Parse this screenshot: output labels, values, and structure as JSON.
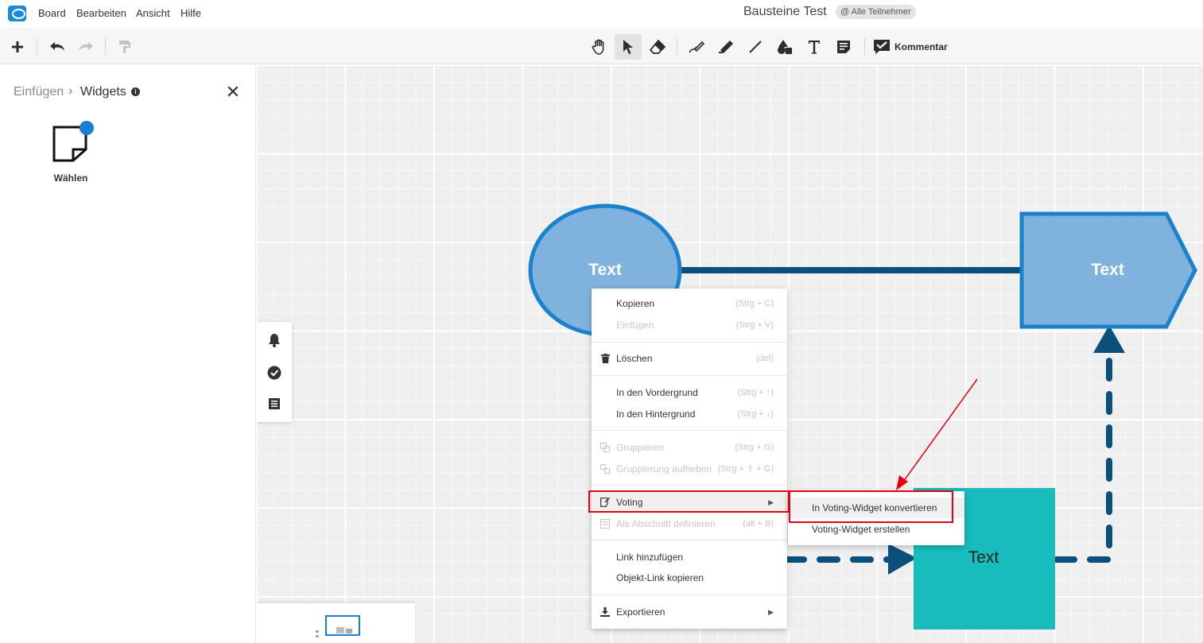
{
  "menubar": {
    "items": [
      "Board",
      "Bearbeiten",
      "Ansicht",
      "Hilfe"
    ],
    "board_title": "Bausteine Test",
    "participants": "@ Alle Teilnehmer"
  },
  "toolbar": {
    "comment_label": "Kommentar"
  },
  "sidebar": {
    "breadcrumb_root": "Einfügen",
    "breadcrumb_sep": "›",
    "breadcrumb_current": "Widgets",
    "close": "✕",
    "widget_label": "Wählen"
  },
  "diagram": {
    "ellipse_text": "Text",
    "pentagon_text": "Text",
    "square_text": "Text",
    "colors": {
      "shape_fill": "#7fb2dd",
      "shape_border": "#1a82cc",
      "connector": "#0b4f7d",
      "square_fill": "#18bcbc"
    }
  },
  "context_menu": {
    "items": [
      {
        "label": "Kopieren",
        "shortcut": "(Strg + C)"
      },
      {
        "label": "Einfügen",
        "shortcut": "(Strg + V)"
      },
      {
        "label": "Löschen",
        "shortcut": "(del)"
      },
      {
        "label": "In den Vordergrund",
        "shortcut": "(Strg + ↑)"
      },
      {
        "label": "In den Hintergrund",
        "shortcut": "(Strg + ↓)"
      },
      {
        "label": "Gruppieren",
        "shortcut": "(Strg + G)"
      },
      {
        "label": "Gruppierung aufheben",
        "shortcut": "(Strg + ⇧ + G)"
      },
      {
        "label": "Voting"
      },
      {
        "label": "Als Abschnitt definieren",
        "shortcut": "(alt + B)"
      },
      {
        "label": "Link hinzufügen"
      },
      {
        "label": "Objekt-Link kopieren"
      },
      {
        "label": "Exportieren"
      }
    ],
    "submenu": [
      {
        "label": "In Voting-Widget konvertieren"
      },
      {
        "label": "Voting-Widget erstellen"
      }
    ]
  },
  "annotation": {
    "color": "#e3000f"
  }
}
